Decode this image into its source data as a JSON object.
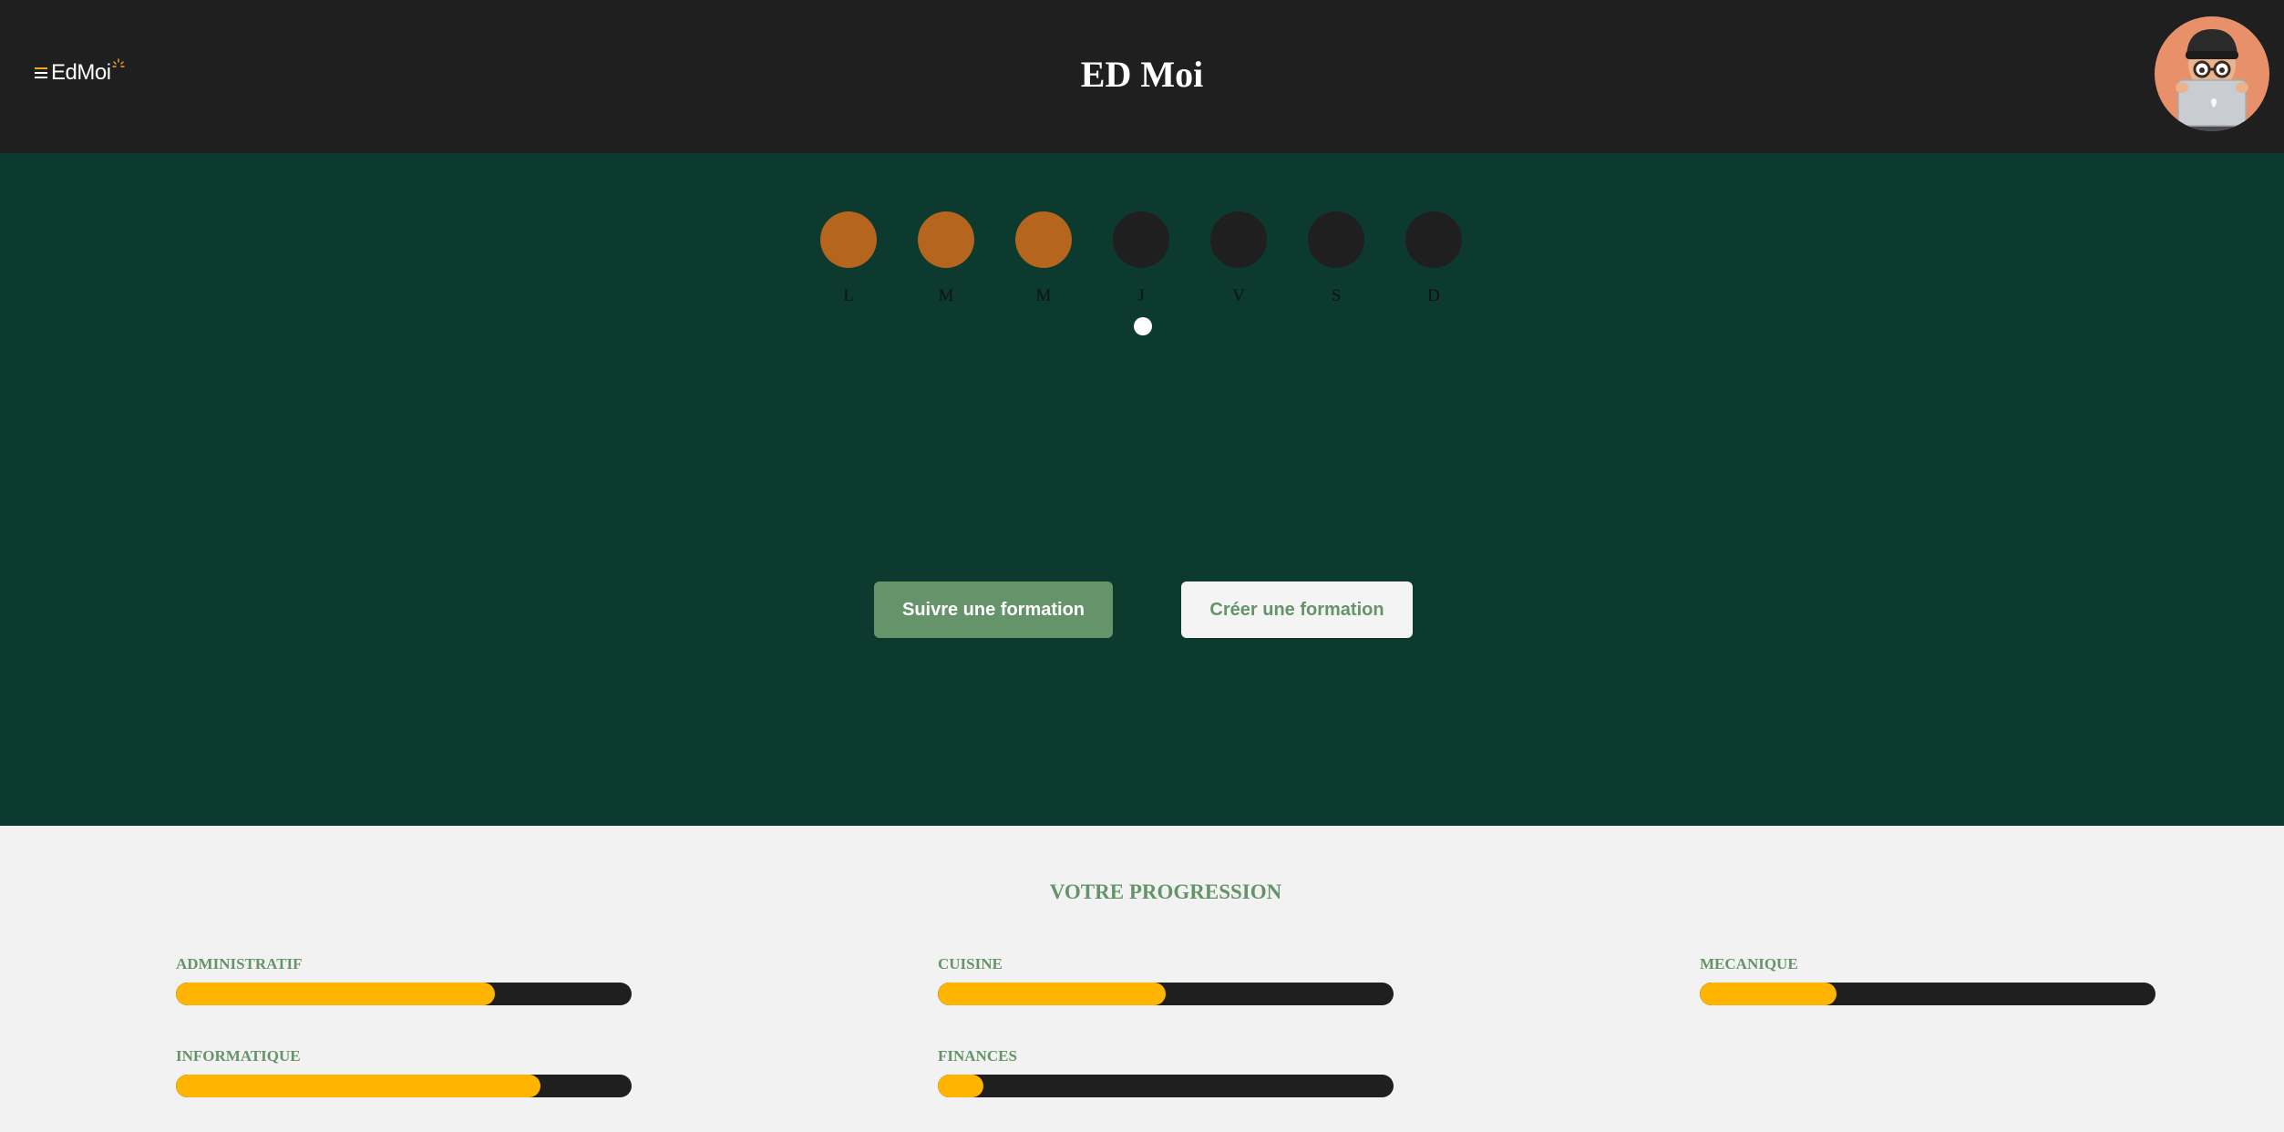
{
  "header": {
    "logo_text": "EdMoi",
    "title": "ED Moi",
    "avatar_icon": "memoji-avatar-icon"
  },
  "week": {
    "days": [
      {
        "letter": "L",
        "done": true
      },
      {
        "letter": "M",
        "done": true
      },
      {
        "letter": "M",
        "done": true
      },
      {
        "letter": "J",
        "done": false
      },
      {
        "letter": "V",
        "done": false
      },
      {
        "letter": "S",
        "done": false
      },
      {
        "letter": "D",
        "done": false
      }
    ],
    "today_index": 3
  },
  "actions": {
    "follow_label": "Suivre une formation",
    "create_label": "Créer une formation"
  },
  "progress": {
    "title": "VOTRE PROGRESSION",
    "items": [
      {
        "label": "ADMINISTRATIF",
        "value": 0.7
      },
      {
        "label": "CUISINE",
        "value": 0.5
      },
      {
        "label": "MECANIQUE",
        "value": 0.3
      },
      {
        "label": "INFORMATIQUE",
        "value": 0.8
      },
      {
        "label": "FINANCES",
        "value": 0.1
      }
    ]
  },
  "colors": {
    "header_bg": "#1f1f1f",
    "hero_bg": "#0c3a2e",
    "accent_green": "#66946a",
    "day_done": "#b5651d",
    "progress_fill": "#ffb400",
    "progress_track": "#1f1f1f"
  }
}
